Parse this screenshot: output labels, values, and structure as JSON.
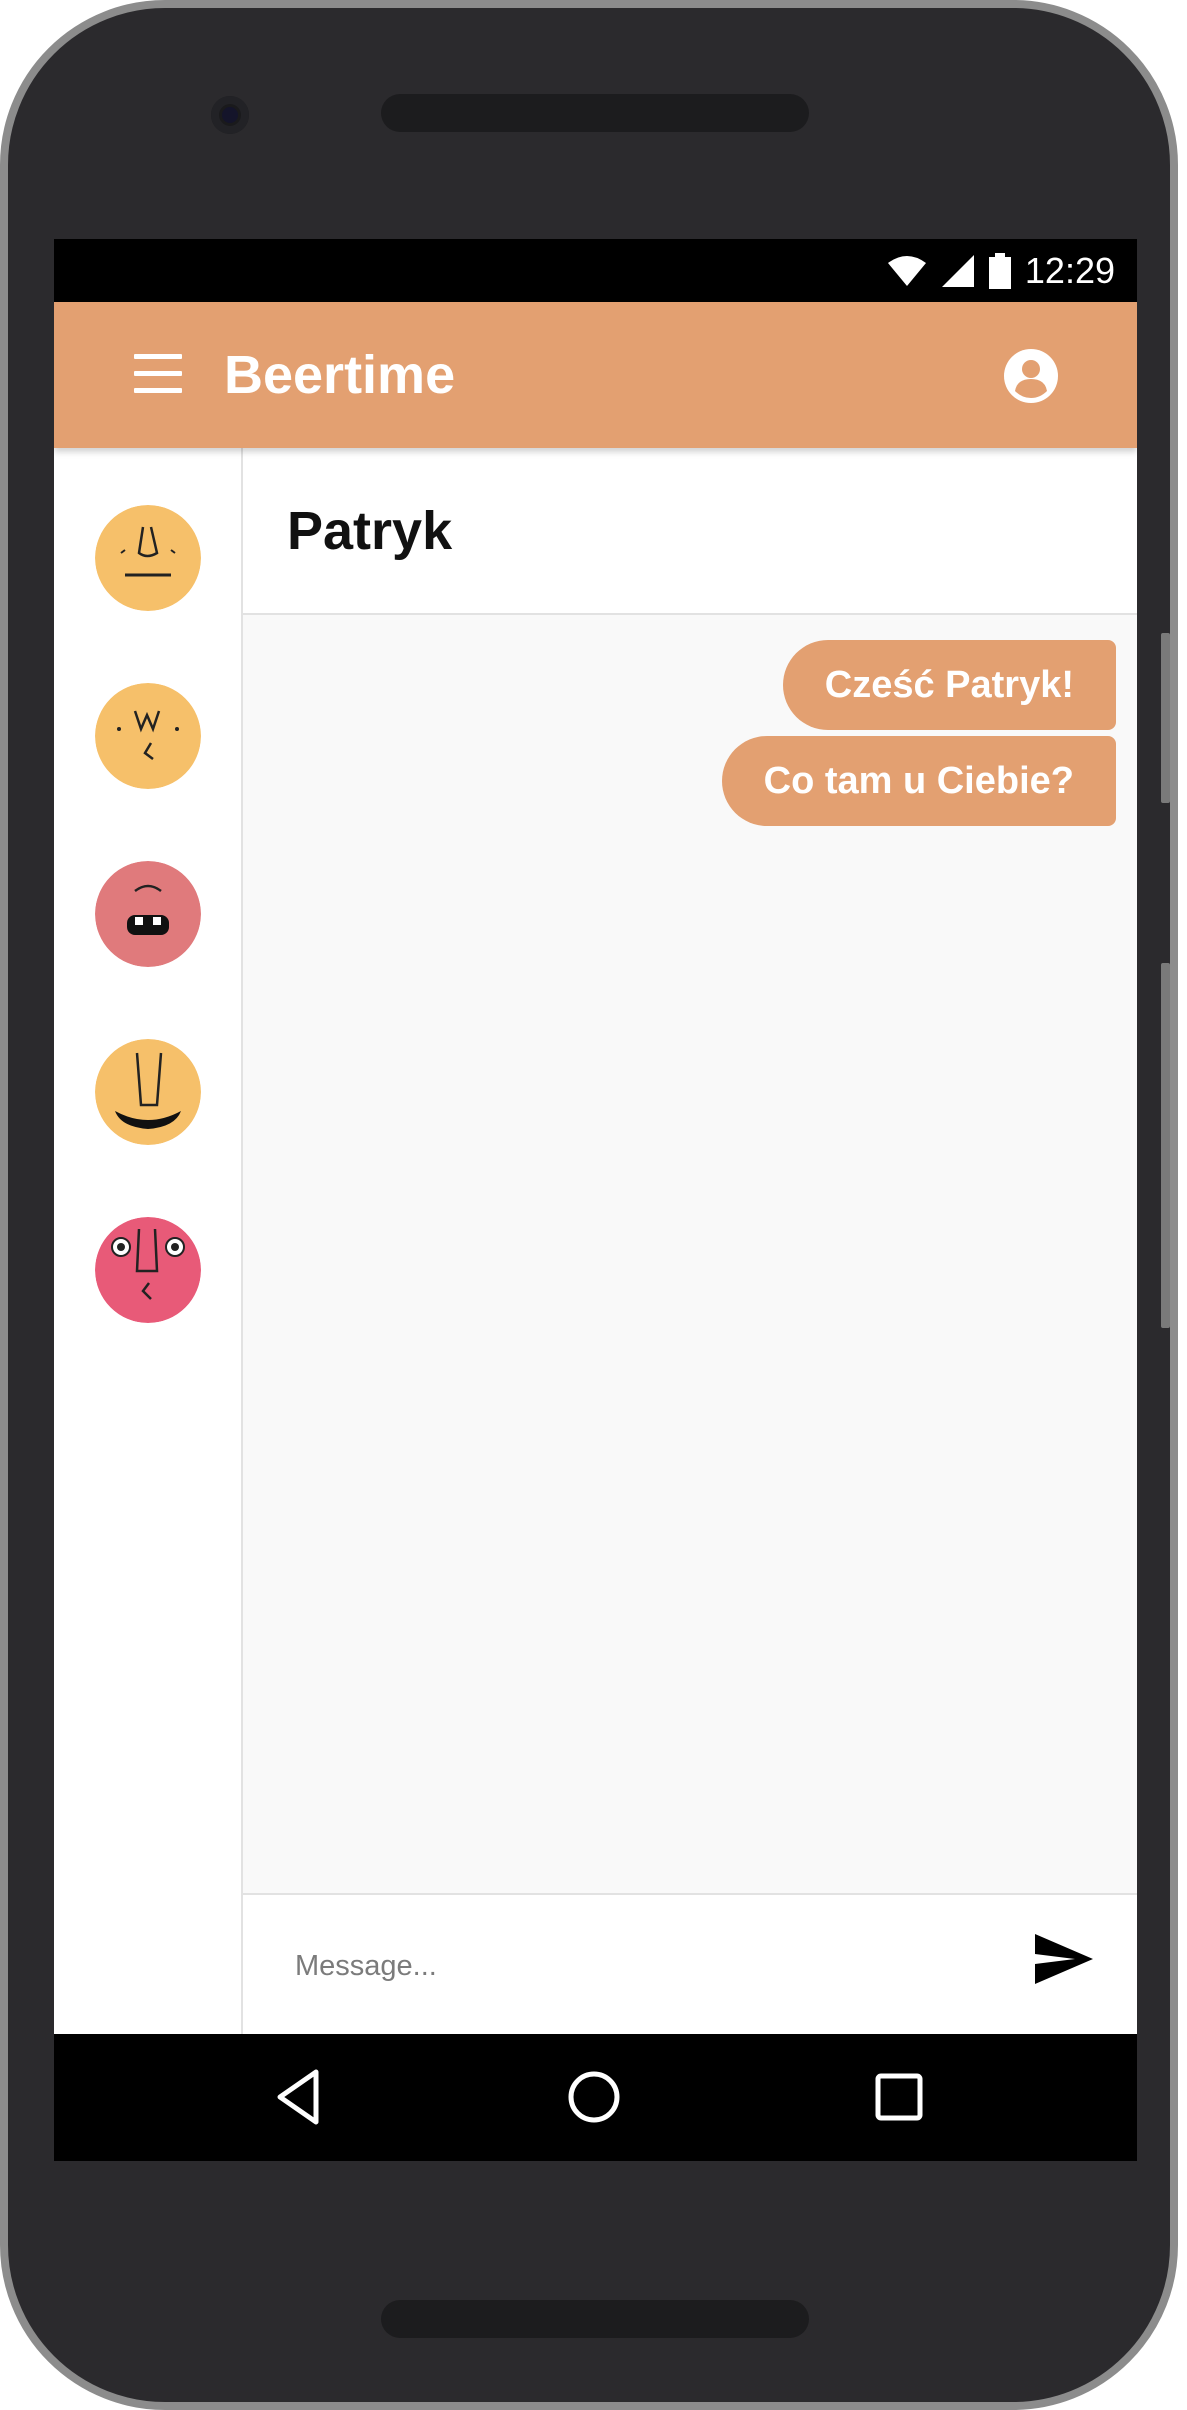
{
  "status_bar": {
    "time": "12:29",
    "icons": [
      "wifi-icon",
      "signal-icon",
      "battery-icon"
    ]
  },
  "app_bar": {
    "title": "Beertime",
    "menu_icon": "menu-icon",
    "account_icon": "account-circle-icon",
    "color": "#e3a071"
  },
  "contacts": [
    {
      "name": "contact-avatar-1",
      "color": "#f6c06a"
    },
    {
      "name": "contact-avatar-2",
      "color": "#f6c06a"
    },
    {
      "name": "contact-avatar-3",
      "color": "#e07a7c"
    },
    {
      "name": "contact-avatar-4",
      "color": "#f6c06a"
    },
    {
      "name": "contact-avatar-5",
      "color": "#e85a78"
    }
  ],
  "chat": {
    "contact_name": "Patryk",
    "messages": [
      {
        "text": "Cześć Patryk!",
        "from": "me"
      },
      {
        "text": "Co tam u Ciebie?",
        "from": "me"
      }
    ]
  },
  "composer": {
    "placeholder": "Message...",
    "value": "",
    "send_icon": "send-icon"
  },
  "nav_bar": {
    "icons": [
      "back-icon",
      "home-icon",
      "recents-icon"
    ]
  }
}
